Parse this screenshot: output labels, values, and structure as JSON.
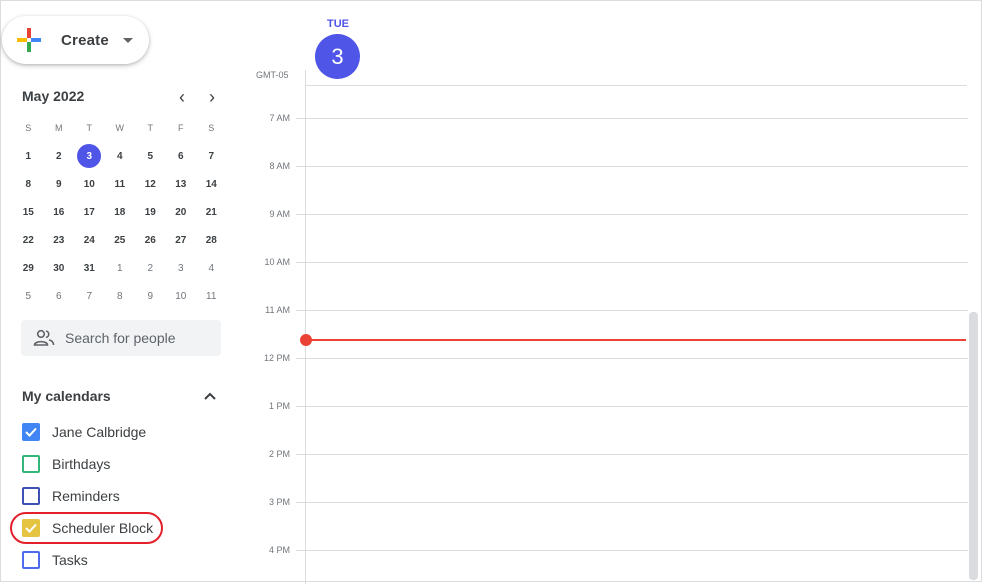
{
  "create": {
    "label": "Create"
  },
  "mini_calendar": {
    "title": "May 2022",
    "prev_icon": "‹",
    "next_icon": "›",
    "weekdays": [
      "S",
      "M",
      "T",
      "W",
      "T",
      "F",
      "S"
    ],
    "weeks": [
      [
        "1",
        "2",
        "3",
        "4",
        "5",
        "6",
        "7"
      ],
      [
        "8",
        "9",
        "10",
        "11",
        "12",
        "13",
        "14"
      ],
      [
        "15",
        "16",
        "17",
        "18",
        "19",
        "20",
        "21"
      ],
      [
        "22",
        "23",
        "24",
        "25",
        "26",
        "27",
        "28"
      ],
      [
        "29",
        "30",
        "31",
        "1",
        "2",
        "3",
        "4"
      ],
      [
        "5",
        "6",
        "7",
        "8",
        "9",
        "10",
        "11"
      ]
    ],
    "today": "3"
  },
  "search_people": {
    "placeholder": "Search for people",
    "icon": "people-icon"
  },
  "my_calendars": {
    "title": "My calendars",
    "items": [
      {
        "label": "Jane Calbridge",
        "checked": true,
        "color": "#4285f4"
      },
      {
        "label": "Birthdays",
        "checked": false,
        "color": "#33b679"
      },
      {
        "label": "Reminders",
        "checked": false,
        "color": "#3f51b5"
      },
      {
        "label": "Scheduler Block",
        "checked": true,
        "color": "#e4c441"
      },
      {
        "label": "Tasks",
        "checked": false,
        "color": "#4f6bed"
      }
    ]
  },
  "day_header": {
    "dow": "TUE",
    "day": "3",
    "timezone": "GMT-05"
  },
  "hours": [
    "7 AM",
    "8 AM",
    "9 AM",
    "10 AM",
    "11 AM",
    "12 PM",
    "1 PM",
    "2 PM",
    "3 PM",
    "4 PM"
  ],
  "colors": {
    "accent": "#4f55e6",
    "now_line": "#ea4335",
    "highlight": "#e3202a"
  }
}
